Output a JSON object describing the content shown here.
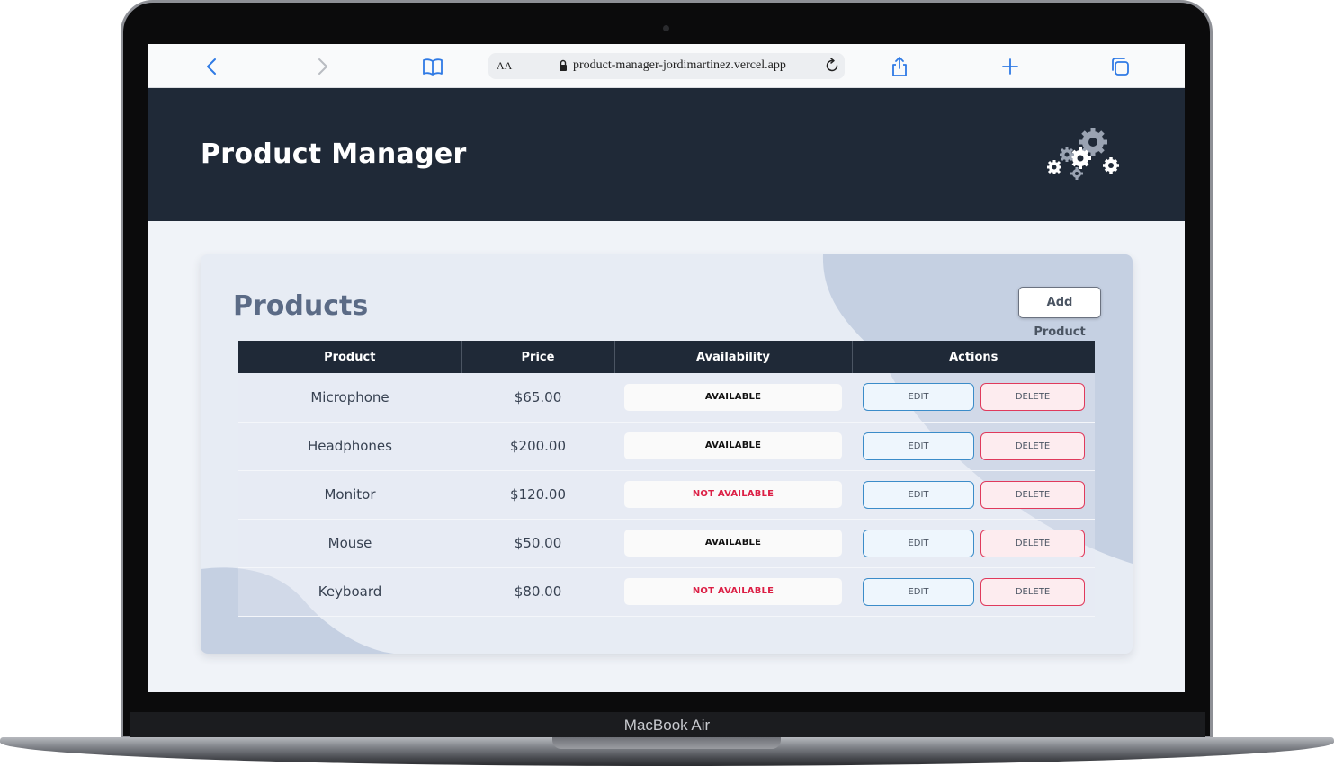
{
  "device": {
    "label": "MacBook Air"
  },
  "browser": {
    "text_size_label": "AA",
    "url": "product-manager-jordimartinez.vercel.app",
    "icons": [
      "chevron-left-icon",
      "chevron-right-icon",
      "book-icon",
      "lock-icon",
      "reload-icon",
      "share-icon",
      "plus-icon",
      "tabs-icon"
    ],
    "accent_color": "#2f7ae5"
  },
  "header": {
    "title": "Product Manager",
    "logo_icon": "gears-icon",
    "background": "#1f2937"
  },
  "products_card": {
    "title": "Products",
    "add_button_label": "Add Product",
    "columns": [
      "Product",
      "Price",
      "Availability",
      "Actions"
    ],
    "rows": [
      {
        "product": "Microphone",
        "price": "$65.00",
        "availability": "AVAILABLE",
        "available": true,
        "edit_label": "EDIT",
        "delete_label": "DELETE"
      },
      {
        "product": "Headphones",
        "price": "$200.00",
        "availability": "AVAILABLE",
        "available": true,
        "edit_label": "EDIT",
        "delete_label": "DELETE"
      },
      {
        "product": "Monitor",
        "price": "$120.00",
        "availability": "NOT AVAILABLE",
        "available": false,
        "edit_label": "EDIT",
        "delete_label": "DELETE"
      },
      {
        "product": "Mouse",
        "price": "$50.00",
        "availability": "AVAILABLE",
        "available": true,
        "edit_label": "EDIT",
        "delete_label": "DELETE"
      },
      {
        "product": "Keyboard",
        "price": "$80.00",
        "availability": "NOT AVAILABLE",
        "available": false,
        "edit_label": "EDIT",
        "delete_label": "DELETE"
      }
    ],
    "colors": {
      "available_text": "#111111",
      "not_available_text": "#dc1f45",
      "edit_border": "#3b8cc9",
      "delete_border": "#e03a5c"
    }
  }
}
